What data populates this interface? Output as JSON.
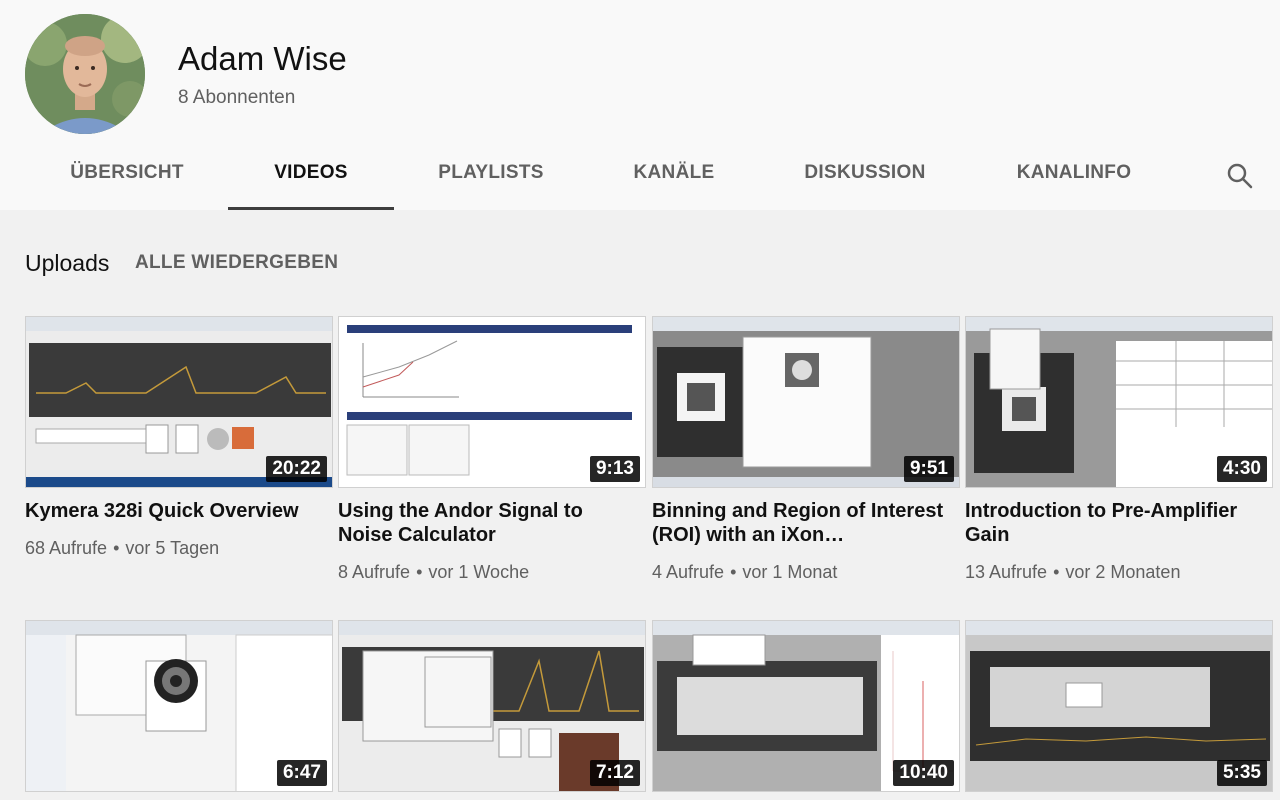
{
  "channel": {
    "name": "Adam Wise",
    "subscribers": "8 Abonnenten"
  },
  "tabs": [
    {
      "label": "ÜBERSICHT",
      "active": false
    },
    {
      "label": "VIDEOS",
      "active": true
    },
    {
      "label": "PLAYLISTS",
      "active": false
    },
    {
      "label": "KANÄLE",
      "active": false
    },
    {
      "label": "DISKUSSION",
      "active": false
    },
    {
      "label": "KANALINFO",
      "active": false
    }
  ],
  "search_icon": "search-icon",
  "uploads": {
    "title": "Uploads",
    "play_all": "ALLE WIEDERGEBEN"
  },
  "videos": [
    {
      "title": "Kymera 328i Quick Overview",
      "duration": "20:22",
      "views": "68 Aufrufe",
      "age": "vor 5 Tagen"
    },
    {
      "title": "Using the Andor Signal to Noise Calculator",
      "duration": "9:13",
      "views": "8 Aufrufe",
      "age": "vor 1 Woche"
    },
    {
      "title": "Binning and Region of Interest (ROI) with an iXon…",
      "duration": "9:51",
      "views": "4 Aufrufe",
      "age": "vor 1 Monat"
    },
    {
      "title": "Introduction to Pre-Amplifier Gain",
      "duration": "4:30",
      "views": "13 Aufrufe",
      "age": "vor 2 Monaten"
    },
    {
      "title": "",
      "duration": "6:47",
      "views": "",
      "age": ""
    },
    {
      "title": "",
      "duration": "7:12",
      "views": "",
      "age": ""
    },
    {
      "title": "",
      "duration": "10:40",
      "views": "",
      "age": ""
    },
    {
      "title": "",
      "duration": "5:35",
      "views": "",
      "age": ""
    }
  ]
}
